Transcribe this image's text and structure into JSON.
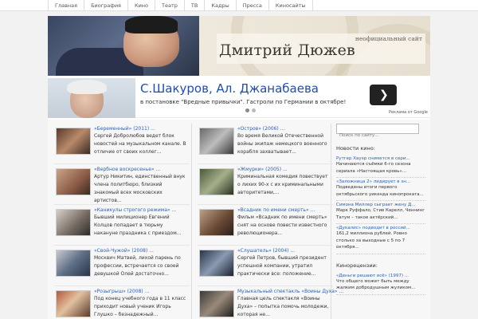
{
  "nav": {
    "items": [
      "Главная",
      "Биография",
      "Кино",
      "Театр",
      "ТВ",
      "Кадры",
      "Пресса",
      "Киносайты"
    ]
  },
  "header": {
    "subtitle": "неофициальный сайт",
    "title": "Дмитрий Дюжев"
  },
  "ad": {
    "title": "С.Шакуров, Ал. Джанабаева",
    "text": "в постановке \"Вредные привычки\". Гастроли по Германии в октябре!",
    "next_icon": "chevron-right-icon",
    "brand": "Реклама от Google"
  },
  "posts_left": [
    {
      "title": "«Беременный» (2011) ...",
      "body": "Сергей Добролюбов ведет блок новостей на музыкальном канале. В отличие от своих коллег..."
    },
    {
      "title": "«Вербное воскресенье» ...",
      "body": "Артур Никитин, единственный внук члена политбюро, близкий знакомый всех московских артистов..."
    },
    {
      "title": "«Каникулы строгого режима» ...",
      "body": "Бывший милиционер Евгений Колцов попадает в тюрьму накануне праздника с приездом..."
    },
    {
      "title": "«Свой-Чужой» (2008) ...",
      "body": "Москвич Матвей, лихой парень по профессии, встречается со своей девушкой Олей достаточно..."
    },
    {
      "title": "«Розыгрыш» (2008) ...",
      "body": "Под конец учебного года в 11 класс приходит новый ученик Игорь Глушко – безнадежный..."
    }
  ],
  "posts_right": [
    {
      "title": "«Остров» (2006) ...",
      "body": "Во время Великой Отечественной войны экипаж немецкого военного корабля захватывает..."
    },
    {
      "title": "«Жмурки» (2005) ...",
      "body": "Криминальная комедия повествует о лихих 90-х с их криминальными авторитетами,..."
    },
    {
      "title": "«Всадник по имени смерть» ...",
      "body": "Фильм «Всадник по имени смерть» снят на основе повести известного революционера..."
    },
    {
      "title": "«Слушатель» (2004) ...",
      "body": "Сергей Петров, бывший президент успешной компании, утратил практически все: положение..."
    },
    {
      "title": "Музыкальный спектакль «Воины Духа» ...",
      "body": "Главная цель спектакля «Воины Духа» – попытка помочь молодежи, которая не..."
    }
  ],
  "sidebar": {
    "search_placeholder": "Поиск по сайту...",
    "news_heading": "Новости кино:",
    "news": [
      {
        "title": "Рутгер Хауэр снимется в сери...",
        "body": "Начинаются съёмки 6-го сезона сериала «Настоящая кровь»..."
      },
      {
        "title": "«Заложница 2» лидирует в зн...",
        "body": "Подведены итоги первого октябрьского уикенда кинопроката..."
      },
      {
        "title": "Симона Миллер сыграет жену Д...",
        "body": "Марк Руффало, Стив Карелл, Ченнинг Татум – такое актёрский..."
      },
      {
        "title": "«Дукалис» подводит в россий...",
        "body": "161,2 миллиона рублей. Ровно столько за выходные с 5 по 7 октября..."
      }
    ],
    "reviews_heading": "Кинорецензии:",
    "reviews": [
      {
        "title": "«Деньги решают всё» (1997) ...",
        "body": "Что общего может быть между жалким добродушным жуликом..."
      }
    ]
  }
}
